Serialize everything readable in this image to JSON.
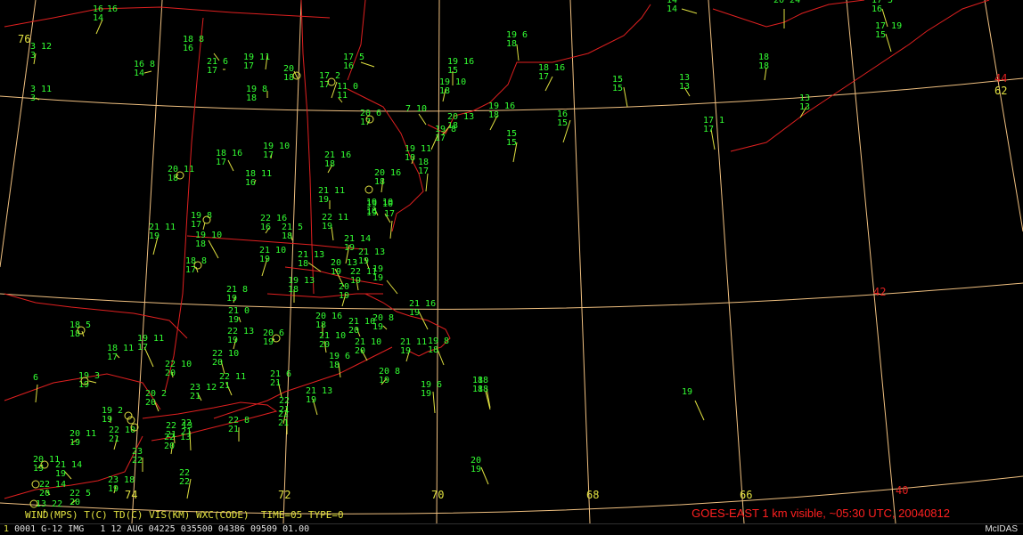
{
  "colors": {
    "background": "#000000",
    "coast": "#e02020",
    "grid": "#f0c080",
    "station_text": "#33ff33",
    "barb": "#e0e040",
    "legend": "#e0e040",
    "product": "#ff2020"
  },
  "grid": {
    "lon_labels": [
      "74",
      "72",
      "70",
      "68",
      "66"
    ],
    "lat_labels": [
      "44",
      "42",
      "40"
    ],
    "edge_labels": [
      "76",
      "62"
    ]
  },
  "stations": [
    {
      "t": "16",
      "td": "14",
      "b": "16"
    },
    {
      "t": "18 8",
      "td": "16",
      "b": ""
    },
    {
      "t": "21 6",
      "td": "17",
      "b": ""
    },
    {
      "t": "19 11",
      "td": "17",
      "b": ""
    },
    {
      "t": "16 8",
      "td": "14",
      "b": ""
    },
    {
      "t": "20",
      "td": "18",
      "b": ""
    },
    {
      "t": "17 5",
      "td": "16",
      "b": ""
    },
    {
      "t": "17 2",
      "td": "17",
      "b": ""
    },
    {
      "t": "11 0",
      "td": "11",
      "b": ""
    },
    {
      "t": "19 8",
      "td": "18",
      "b": ""
    },
    {
      "t": "3 11",
      "td": "3",
      "b": ""
    },
    {
      "t": "3 12",
      "td": "3",
      "b": ""
    },
    {
      "t": "19 6",
      "td": "18",
      "b": ""
    },
    {
      "t": "19 16",
      "td": "15",
      "b": ""
    },
    {
      "t": "18 16",
      "td": "17",
      "b": ""
    },
    {
      "t": "19 10",
      "td": "18",
      "b": ""
    },
    {
      "t": "15",
      "td": "15",
      "b": ""
    },
    {
      "t": "13",
      "td": "13",
      "b": ""
    },
    {
      "t": "18",
      "td": "18",
      "b": ""
    },
    {
      "t": "20 6",
      "td": "17",
      "b": ""
    },
    {
      "t": "7 10",
      "td": "",
      "b": ""
    },
    {
      "t": "20 13",
      "td": "18",
      "b": ""
    },
    {
      "t": "19 16",
      "td": "18",
      "b": ""
    },
    {
      "t": "16",
      "td": "15",
      "b": ""
    },
    {
      "t": "17 1",
      "td": "17",
      "b": ""
    },
    {
      "t": "13",
      "td": "13",
      "b": ""
    },
    {
      "t": "19 8",
      "td": "17",
      "b": ""
    },
    {
      "t": "15",
      "td": "15",
      "b": ""
    },
    {
      "t": "18 16",
      "td": "17",
      "b": ""
    },
    {
      "t": "19 10",
      "td": "17",
      "b": ""
    },
    {
      "t": "21 16",
      "td": "18",
      "b": ""
    },
    {
      "t": "19 11",
      "td": "18",
      "b": ""
    },
    {
      "t": "20 11",
      "td": "18",
      "b": ""
    },
    {
      "t": "18 11",
      "td": "16",
      "b": ""
    },
    {
      "t": "20 16",
      "td": "18",
      "b": ""
    },
    {
      "t": "18",
      "td": "17",
      "b": ""
    },
    {
      "t": "21 11",
      "td": "19",
      "b": ""
    },
    {
      "t": "19 10",
      "td": "18",
      "b": ""
    },
    {
      "t": "19 10",
      "td": "19",
      "b": ""
    },
    {
      "t": "22 16",
      "td": "16",
      "b": ""
    },
    {
      "t": "21 5",
      "td": "18",
      "b": ""
    },
    {
      "t": "22 11",
      "td": "19",
      "b": ""
    },
    {
      "t": "17",
      "td": "",
      "b": ""
    },
    {
      "t": "19 8",
      "td": "17",
      "b": ""
    },
    {
      "t": "21 11",
      "td": "19",
      "b": ""
    },
    {
      "t": "19 10",
      "td": "18",
      "b": ""
    },
    {
      "t": "21 14",
      "td": "19",
      "b": ""
    },
    {
      "t": "21 10",
      "td": "19",
      "b": ""
    },
    {
      "t": "21 13",
      "td": "18",
      "b": ""
    },
    {
      "t": "20 13",
      "td": "19",
      "b": ""
    },
    {
      "t": "21 13",
      "td": "19",
      "b": ""
    },
    {
      "t": "18 8",
      "td": "17",
      "b": ""
    },
    {
      "t": "22 11",
      "td": "19",
      "b": ""
    },
    {
      "t": "19",
      "td": "19",
      "b": ""
    },
    {
      "t": "19 13",
      "td": "18",
      "b": ""
    },
    {
      "t": "21 8",
      "td": "19",
      "b": ""
    },
    {
      "t": "20",
      "td": "19",
      "b": ""
    },
    {
      "t": "21 16",
      "td": "19",
      "b": ""
    },
    {
      "t": "21 0",
      "td": "19",
      "b": ""
    },
    {
      "t": "20 16",
      "td": "18",
      "b": ""
    },
    {
      "t": "21 10",
      "td": "20",
      "b": ""
    },
    {
      "t": "20 8",
      "td": "19",
      "b": ""
    },
    {
      "t": "18 5",
      "td": "18",
      "b": ""
    },
    {
      "t": "22 13",
      "td": "19",
      "b": ""
    },
    {
      "t": "20 6",
      "td": "19",
      "b": ""
    },
    {
      "t": "21 10",
      "td": "20",
      "b": ""
    },
    {
      "t": "21 10",
      "td": "20",
      "b": ""
    },
    {
      "t": "21 11",
      "td": "19",
      "b": ""
    },
    {
      "t": "19 8",
      "td": "18",
      "b": ""
    },
    {
      "t": "18 11",
      "td": "17",
      "b": ""
    },
    {
      "t": "19 11",
      "td": "17",
      "b": ""
    },
    {
      "t": "22 10",
      "td": "20",
      "b": ""
    },
    {
      "t": "22 10",
      "td": "20",
      "b": ""
    },
    {
      "t": "19 6",
      "td": "18",
      "b": ""
    },
    {
      "t": "19 3",
      "td": "19",
      "b": ""
    },
    {
      "t": "20 2",
      "td": "20",
      "b": ""
    },
    {
      "t": "23 12",
      "td": "21",
      "b": ""
    },
    {
      "t": "22 11",
      "td": "21",
      "b": ""
    },
    {
      "t": "21 6",
      "td": "21",
      "b": ""
    },
    {
      "t": "21 13",
      "td": "19",
      "b": ""
    },
    {
      "t": "20 8",
      "td": "19",
      "b": ""
    },
    {
      "t": "18",
      "td": "18",
      "b": ""
    },
    {
      "t": "19 6",
      "td": "19",
      "b": ""
    },
    {
      "t": "19 2",
      "td": "19",
      "b": ""
    },
    {
      "t": "22",
      "td": "21",
      "b": ""
    },
    {
      "t": "22",
      "td": "21",
      "b": ""
    },
    {
      "t": "22 8",
      "td": "21",
      "b": ""
    },
    {
      "t": "22 13",
      "td": "21",
      "b": ""
    },
    {
      "t": "22 13",
      "td": "20",
      "b": ""
    },
    {
      "t": "22 10",
      "td": "21",
      "b": ""
    },
    {
      "t": "20 11",
      "td": "19",
      "b": ""
    },
    {
      "t": "22",
      "td": "21",
      "b": ""
    },
    {
      "t": "23",
      "td": "22",
      "b": ""
    },
    {
      "t": "20 11",
      "td": "19",
      "b": ""
    },
    {
      "t": "21 14",
      "td": "19",
      "b": ""
    },
    {
      "t": "22 14",
      "td": "20",
      "b": ""
    },
    {
      "t": "22 5",
      "td": "20",
      "b": ""
    },
    {
      "t": "23 18",
      "td": "19",
      "b": ""
    },
    {
      "t": "22",
      "td": "22",
      "b": ""
    },
    {
      "t": "13 22",
      "td": "",
      "b": ""
    },
    {
      "t": "20",
      "td": "19",
      "b": ""
    },
    {
      "t": "19",
      "td": "",
      "b": ""
    },
    {
      "t": "6",
      "td": "",
      "b": ""
    },
    {
      "t": "18",
      "td": "18",
      "b": ""
    },
    {
      "t": "20 24",
      "td": "",
      "b": ""
    },
    {
      "t": "14",
      "td": "14",
      "b": ""
    },
    {
      "t": "17 5",
      "td": "16",
      "b": ""
    },
    {
      "t": "17 19",
      "td": "15",
      "b": ""
    }
  ],
  "legend": "WIND(MPS) T(C) TD(C) VIS(KM) WXC(CODE)  TIME=05 TYPE=0",
  "product": "GOES-EAST 1 km visible, ~05:30 UTC, 20040812",
  "status": {
    "frame": "1",
    "text": "0001 G-12 IMG   1 12 AUG 04225 035500 04386 09509 01.00"
  },
  "brand": "McIDAS"
}
